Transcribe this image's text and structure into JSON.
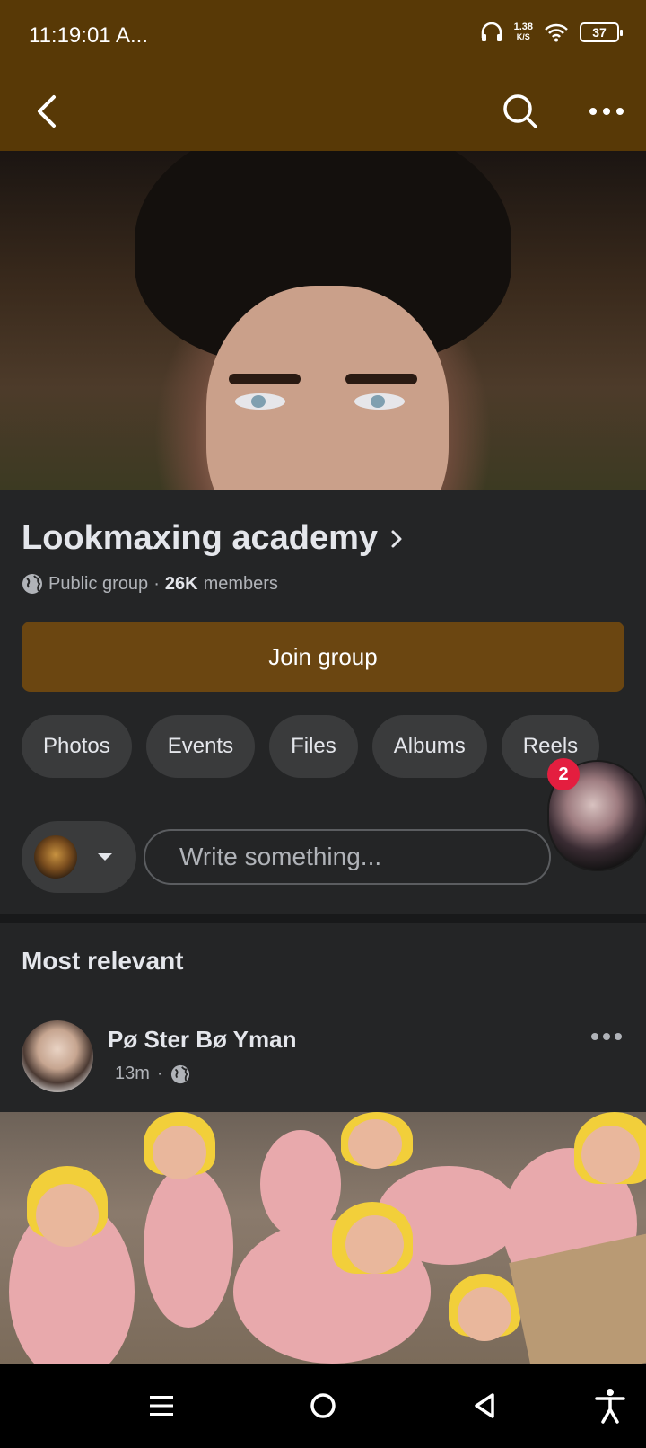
{
  "status_bar": {
    "time": "11:19:01 A...",
    "net_speed_value": "1.38",
    "net_speed_unit": "K/S",
    "battery": "37"
  },
  "app_bar": {
    "back_icon": "chevron-left-icon",
    "search_icon": "search-icon",
    "more_icon": "more-horizontal-icon"
  },
  "group": {
    "name": "Lookmaxing academy",
    "privacy": "Public group",
    "separator": "·",
    "member_count": "26K",
    "member_label": "members",
    "join_label": "Join group"
  },
  "tabs": [
    "Photos",
    "Events",
    "Files",
    "Albums",
    "Reels"
  ],
  "chat_head": {
    "badge": "2"
  },
  "composer": {
    "placeholder": "Write something..."
  },
  "feed": {
    "sort_label": "Most relevant",
    "post": {
      "author": "Pø Ster Bø Yman",
      "time": "13m",
      "separator": "·",
      "privacy_icon": "globe-icon"
    }
  },
  "colors": {
    "app_bar": "#583906",
    "join_button": "#6b4611",
    "surface": "#242526",
    "chip": "#3a3b3c",
    "badge": "#e41e3f"
  }
}
